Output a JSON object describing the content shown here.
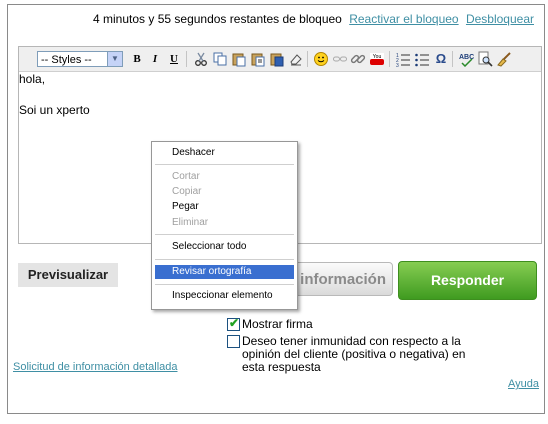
{
  "lock": {
    "status": "4 minutos y 55 segundos restantes de bloqueo",
    "reactivate_link": "Reactivar el bloqueo",
    "unlock_link": "Desbloquear"
  },
  "editor": {
    "styles_select": "-- Styles --",
    "toolbar": {
      "bold": "B",
      "italic": "I",
      "underline": "U",
      "omega": "Ω"
    },
    "content": {
      "line1": "hola,",
      "line2": "Soi un xperto"
    }
  },
  "context_menu": {
    "undo": "Deshacer",
    "cut": "Cortar",
    "copy": "Copiar",
    "paste": "Pegar",
    "delete": "Eliminar",
    "select_all": "Seleccionar todo",
    "spellcheck": "Revisar ortografía",
    "inspect": "Inspeccionar elemento"
  },
  "buttons": {
    "preview": "Previsualizar",
    "info": "información",
    "reply": "Responder"
  },
  "options": {
    "show_signature": "Mostrar firma",
    "show_signature_checked": true,
    "immunity_line1": "Deseo tener inmunidad con respecto a la",
    "immunity_line2": "opinión del cliente (positiva o negativa) en",
    "immunity_line3": "esta respuesta",
    "immunity_checked": false
  },
  "links": {
    "detailed_info_request": "Solicitud de información detallada",
    "help": "Ayuda"
  },
  "colors": {
    "link": "#3f8fa4",
    "reply_button": "#4ca82a",
    "menu_highlight": "#3a6fd0"
  }
}
